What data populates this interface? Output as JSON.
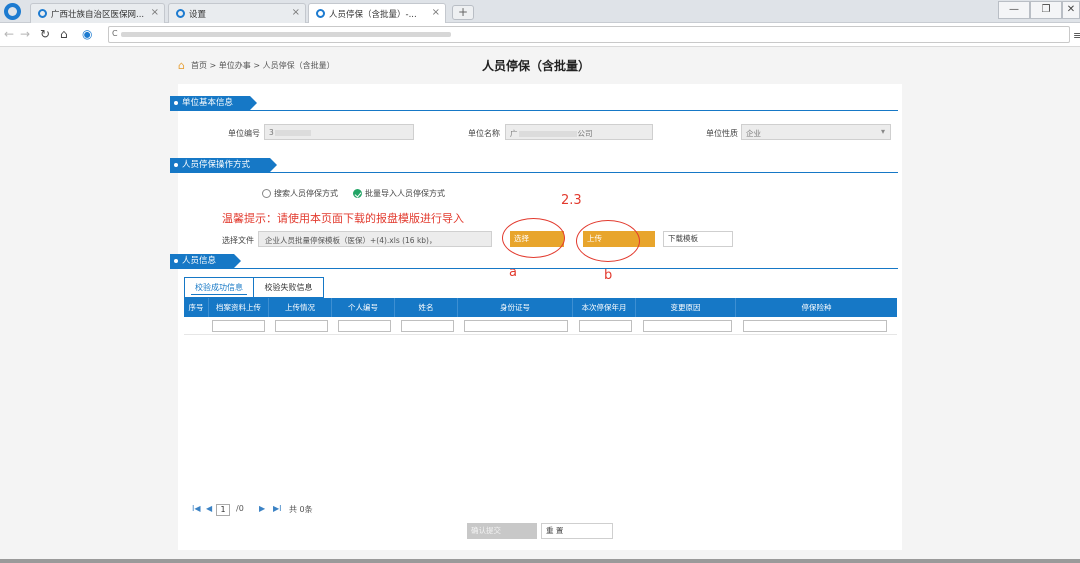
{
  "browser": {
    "tabs": [
      {
        "label": "广西壮族自治区医保网...",
        "close": "×"
      },
      {
        "label": "设置",
        "close": "×"
      },
      {
        "label": "人员停保（含批量）-...",
        "close": "×"
      }
    ],
    "new_tab": "+",
    "window": {
      "minimize": "—",
      "maximize": "❐",
      "close": "✕"
    },
    "address_prefix": "C"
  },
  "breadcrumb": "首页 > 单位办事 > 人员停保（含批量）",
  "page_title": "人员停保（含批量）",
  "sections": {
    "unit_info": "单位基本信息",
    "operation_mode": "人员停保操作方式",
    "person_info": "人员信息"
  },
  "unit": {
    "code_label": "单位编号",
    "code_value": "3",
    "name_label": "单位名称",
    "name_prefix": "广",
    "name_suffix": "公司",
    "nature_label": "单位性质",
    "nature_value": "企业"
  },
  "mode": {
    "option_search": "搜索人员停保方式",
    "option_batch": "批量导入人员停保方式"
  },
  "tip": "温馨提示：请使用本页面下载的报盘模版进行导入",
  "upload": {
    "file_label": "选择文件",
    "file_value": "企业人员批量停保模板（医保）+(4).xls (16 kb)，",
    "select_button": "选择",
    "upload_button": "上传",
    "download_button": "下载模板"
  },
  "annotations": {
    "step": "2.3",
    "a": "a",
    "b": "b"
  },
  "result_tabs": [
    "校验成功信息",
    "校验失败信息"
  ],
  "table": {
    "columns": [
      "序号",
      "档案资料上传",
      "上传情况",
      "个人编号",
      "姓名",
      "身份证号",
      "本次停保年月",
      "变更原因",
      "停保险种"
    ]
  },
  "pager": {
    "first": "I◀",
    "prev": "◀",
    "page": "1",
    "total": "/0",
    "next": "▶",
    "last": "▶I",
    "count": "共 0条"
  },
  "actions": {
    "confirm": "确认提交",
    "reset": "重 置"
  },
  "colors": {
    "primary": "#1678c6",
    "accent": "#e8a52c",
    "annotation": "#e23a2e"
  }
}
